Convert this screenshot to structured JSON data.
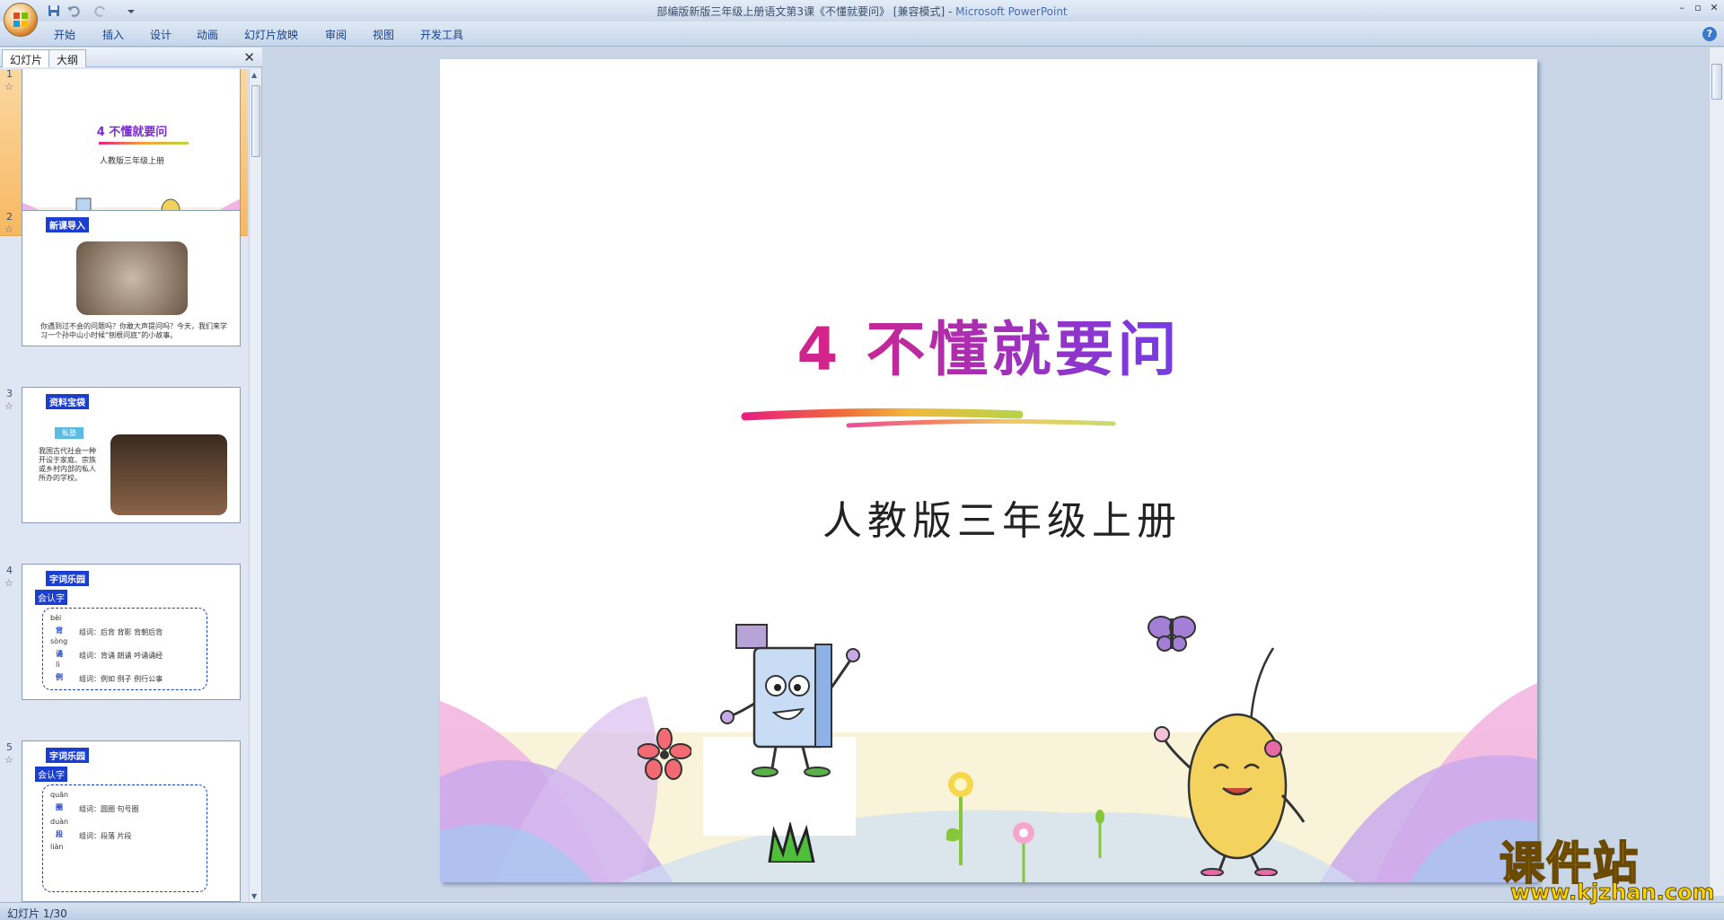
{
  "window": {
    "title": "部编版新版三年级上册语文第3课《不懂就要问》 [兼容模式] - ",
    "app_name": "Microsoft PowerPoint",
    "controls": [
      "–",
      "▫",
      "✕"
    ]
  },
  "ribbon": {
    "tabs": [
      "开始",
      "插入",
      "设计",
      "动画",
      "幻灯片放映",
      "审阅",
      "视图",
      "开发工具"
    ],
    "help": "?"
  },
  "left_pane": {
    "tabs": [
      "幻灯片",
      "大纲"
    ],
    "close": "✕",
    "thumbnails": [
      {
        "number": "1",
        "star": "☆",
        "title": "4 不懂就要问",
        "subtitle": "人教版三年级上册"
      },
      {
        "number": "2",
        "star": "☆",
        "tag": "新课导入",
        "text": "你遇到过不会的问题吗？你敢大声提问吗？今天，我们来学习一个孙中山小时候“刨根问底”的小故事。"
      },
      {
        "number": "3",
        "star": "☆",
        "tag": "资料宝袋",
        "label": "私塾",
        "text": "我国古代社会一种开设于家庭、宗族或乡村内部的私人所办的学校。"
      },
      {
        "number": "4",
        "star": "☆",
        "tag": "字词乐园",
        "label": "会认字",
        "rows": [
          {
            "pinyin": "bèi",
            "char": "背",
            "words": "组词：后背  背影  背朝后背"
          },
          {
            "pinyin": "sòng",
            "char": "诵",
            "words": "组词：背诵  朗诵  吟诵诵经"
          },
          {
            "pinyin": "lì",
            "char": "例",
            "words": "组词：例如  例子  例行公事"
          }
        ]
      },
      {
        "number": "5",
        "star": "☆",
        "tag": "字词乐园",
        "label": "会认字",
        "rows": [
          {
            "pinyin": "quān",
            "char": "圈",
            "words": "组词：圆圈  句号圈"
          },
          {
            "pinyin": "duàn",
            "char": "段",
            "words": "组词：段落  片段"
          },
          {
            "pinyin": "liàn",
            "char": "",
            "words": ""
          }
        ]
      }
    ]
  },
  "slide": {
    "title": "4 不懂就要问",
    "subtitle": "人教版三年级上册"
  },
  "status": {
    "text": "幻灯片 1/30"
  },
  "watermark": {
    "main": "课件站",
    "url": "www.kjzhan.com"
  }
}
